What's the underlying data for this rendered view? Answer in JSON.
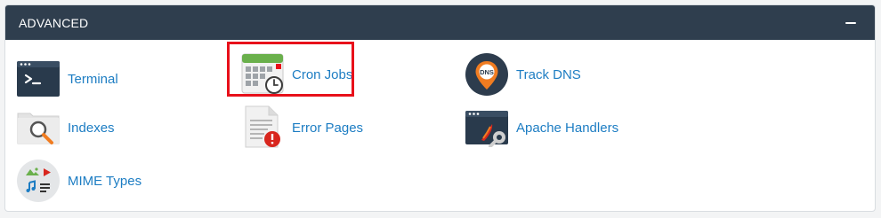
{
  "section": {
    "title": "ADVANCED",
    "collapse_icon": "minus-icon"
  },
  "items": [
    {
      "label": "Terminal",
      "icon": "terminal-icon"
    },
    {
      "label": "Cron Jobs",
      "icon": "calendar-clock-icon"
    },
    {
      "label": "Track DNS",
      "icon": "dns-pin-icon"
    },
    {
      "label": "Indexes",
      "icon": "folder-search-icon"
    },
    {
      "label": "Error Pages",
      "icon": "error-document-icon"
    },
    {
      "label": "Apache Handlers",
      "icon": "window-wrench-icon"
    },
    {
      "label": "MIME Types",
      "icon": "media-types-icon"
    }
  ],
  "dns_badge_text": "DNS",
  "colors": {
    "header_bg": "#2f3e4e",
    "link": "#1d7dc3",
    "highlight_border": "#e8101a"
  }
}
